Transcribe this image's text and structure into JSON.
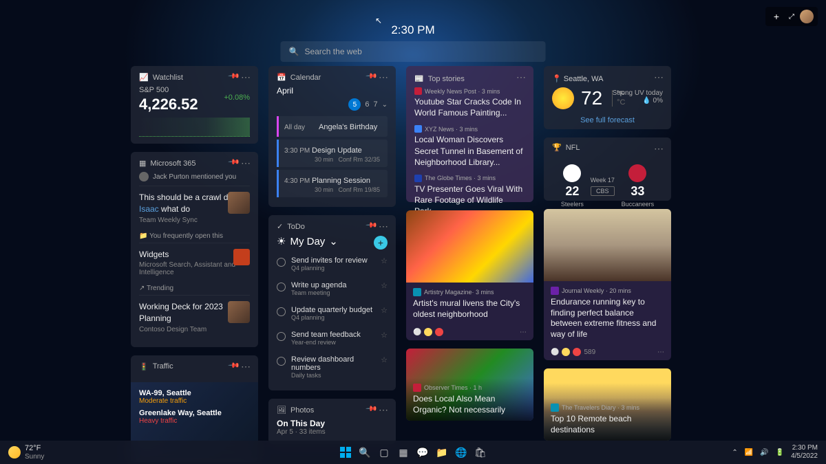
{
  "header": {
    "time": "2:30 PM"
  },
  "search": {
    "placeholder": "Search the web"
  },
  "topright": {
    "plus": "+"
  },
  "watchlist": {
    "title": "Watchlist",
    "symbol": "S&P 500",
    "price": "4,226.52",
    "change": "+0.08%"
  },
  "m365": {
    "title": "Microsoft 365",
    "mention": "Jack Purton mentioned you",
    "quote_pre": "This should be a crawl design ",
    "quote_link": "Isaac",
    "quote_post": " what do",
    "quote_sub": "Team Weekly Sync",
    "freq": "You frequently open this",
    "widgets_title": "Widgets",
    "widgets_sub": "Microsoft Search, Assistant and Intelligence",
    "trending": "Trending",
    "deck_title": "Working Deck for 2023 Planning",
    "deck_sub": "Contoso Design Team"
  },
  "traffic": {
    "title": "Traffic",
    "r1": "WA-99, Seattle",
    "r1s": "Moderate traffic",
    "r2": "Greenlake Way, Seattle",
    "r2s": "Heavy traffic"
  },
  "calendar": {
    "title": "Calendar",
    "month": "April",
    "d1": "5",
    "d2": "6",
    "d3": "7",
    "e1_time": "All day",
    "e1_title": "Angela's Birthday",
    "e2_time": "3:30 PM",
    "e2_dur": "30 min",
    "e2_title": "Design Update",
    "e2_sub": "Conf Rm 32/35",
    "e3_time": "4:30 PM",
    "e3_dur": "30 min",
    "e3_title": "Planning Session",
    "e3_sub": "Conf Rm 19/85"
  },
  "todo": {
    "title": "ToDo",
    "myday": "My Day",
    "t1": "Send invites for review",
    "t1s": "Q4 planning",
    "t2": "Write up agenda",
    "t2s": "Team meeting",
    "t3": "Update quarterly budget",
    "t3s": "Q4 planning",
    "t4": "Send team feedback",
    "t4s": "Year-end review",
    "t5": "Review dashboard numbers",
    "t5s": "Daily tasks"
  },
  "photos": {
    "title": "Photos",
    "ptitle": "On This Day",
    "psub": "Apr 5 · 33 items"
  },
  "topstories": {
    "title": "Top stories",
    "s1_src": "Weekly News Post · 3 mins",
    "s1_t": "Youtube Star Cracks Code In World Famous Painting...",
    "s2_src": "XYZ News · 3 mins",
    "s2_t": "Local Woman Discovers Secret Tunnel in Basement of Neighborhood Library...",
    "s3_src": "The Globe Times · 3 mins",
    "s3_t": "TV Presenter Goes Viral With Rare Footage of Wildlife Park..."
  },
  "news1": {
    "src": "Artistry Magazine· 3 mins",
    "title": "Artist's mural livens the City's oldest neighborhood"
  },
  "news2": {
    "src": "Observer Times · 1 h",
    "title": "Does Local Also Mean Organic? Not necessarily"
  },
  "weather": {
    "loc": "Seattle, WA",
    "temp": "72",
    "unit": "°F\n°C",
    "uv": "Strong UV today",
    "precip": "💧 0%",
    "forecast": "See full forecast"
  },
  "nfl": {
    "title": "NFL",
    "week": "Week 17",
    "t1": "Steelers",
    "s1": "22",
    "t2": "Buccaneers",
    "s2": "33",
    "net": "CBS"
  },
  "news3": {
    "src": "Journal Weekly · 20 mins",
    "title": "Endurance running key to finding perfect balance between extreme fitness and way of life",
    "count": "589"
  },
  "news4": {
    "src": "The Travelers Diary · 3 mins",
    "title": "Top 10 Remote beach destinations"
  },
  "taskbar": {
    "temp": "72°F",
    "cond": "Sunny",
    "time": "2:30 PM",
    "date": "4/5/2022"
  }
}
